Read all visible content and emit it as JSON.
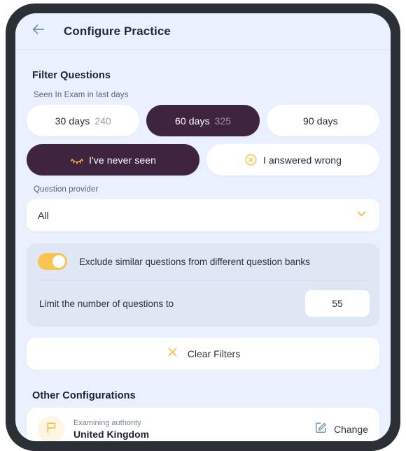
{
  "header": {
    "back_icon": "arrow-left-icon",
    "title": "Configure Practice"
  },
  "filter_section": {
    "title": "Filter Questions",
    "seen_label": "Seen In Exam in last days",
    "day_chips": [
      {
        "label": "30 days",
        "count": "240",
        "selected": false
      },
      {
        "label": "60 days",
        "count": "325",
        "selected": true
      },
      {
        "label": "90 days",
        "count": "",
        "selected": false
      }
    ],
    "status_chips": [
      {
        "label": "I've never seen",
        "icon": "eye-closed-icon",
        "selected": true
      },
      {
        "label": "I answered wrong",
        "icon": "circle-x-icon",
        "selected": false
      }
    ],
    "provider_label": "Question provider",
    "provider_value": "All",
    "provider_chevron_icon": "chevron-down-icon",
    "exclude_toggle_label": "Exclude similar questions from different question banks",
    "exclude_toggle_on": true,
    "limit_label": "Limit the number of questions to",
    "limit_value": "55",
    "clear_filters_label": "Clear Filters",
    "clear_filters_icon": "close-x-icon"
  },
  "other_section": {
    "title": "Other Configurations",
    "authority": {
      "icon": "flag-icon",
      "caption": "Examining authority",
      "value": "United Kingdom",
      "change_label": "Change",
      "change_icon": "edit-square-icon"
    }
  },
  "colors": {
    "accent_gold": "#fbbf3f",
    "selected_purple": "#3f2440",
    "screen_background": "#eaf0fd",
    "panel_background": "#dfe7f5",
    "card_white": "#ffffff",
    "device_bezel": "#2b3036",
    "back_arrow": "#6d91a8"
  }
}
